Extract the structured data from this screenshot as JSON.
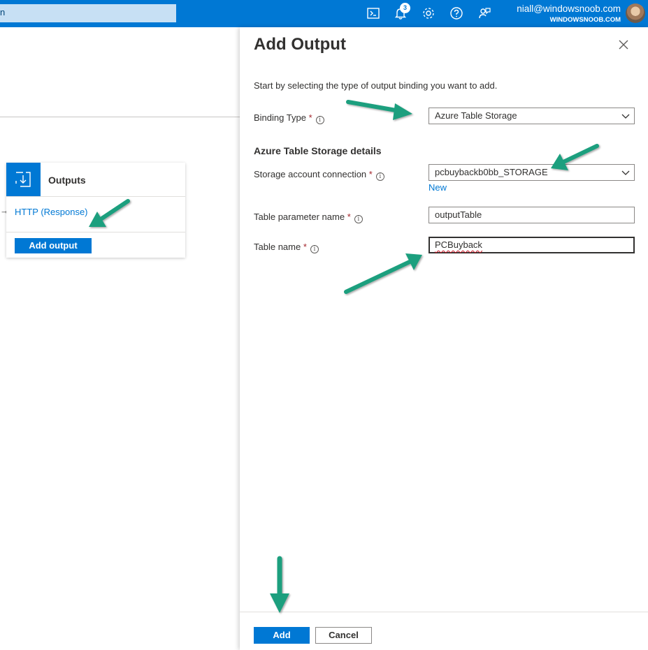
{
  "topbar": {
    "search_fragment": "n",
    "notification_count": "3",
    "user_email": "niall@windowsnoob.com",
    "user_tenant": "WINDOWSNOOB.COM",
    "icons": [
      "cloud-shell-icon",
      "bell-icon",
      "gear-icon",
      "help-icon",
      "feedback-icon"
    ]
  },
  "outputs_card": {
    "title": "Outputs",
    "binding_link": "HTTP (Response)",
    "add_button": "Add output"
  },
  "panel": {
    "title": "Add Output",
    "intro": "Start by selecting the type of output binding you want to add.",
    "binding_type": {
      "label": "Binding Type",
      "required": "*",
      "value": "Azure Table Storage"
    },
    "details_heading": "Azure Table Storage details",
    "storage_connection": {
      "label": "Storage account connection",
      "required": "*",
      "value": "pcbuybackb0bb_STORAGE",
      "new_link": "New"
    },
    "table_parameter": {
      "label": "Table parameter name",
      "required": "*",
      "value": "outputTable"
    },
    "table_name": {
      "label": "Table name",
      "required": "*",
      "value": "PCBuyback"
    },
    "add_button": "Add",
    "cancel_button": "Cancel"
  },
  "colors": {
    "accent": "#0078d4",
    "required": "#a4262c",
    "annotation_arrow": "#1a9f7e"
  }
}
